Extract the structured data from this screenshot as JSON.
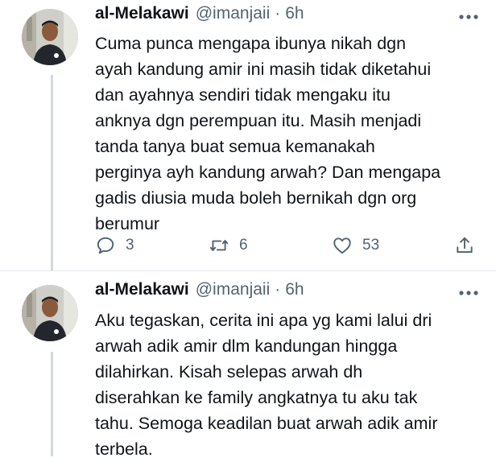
{
  "tweets": [
    {
      "display_name": "al-Melakawi",
      "handle": "@imanjaii",
      "separator": "·",
      "time": "6h",
      "text": "Cuma punca mengapa ibunya nikah dgn\nayah kandung amir ini masih tidak diketahui\ndan ayahnya sendiri tidak mengaku itu\nanknya dgn perempuan itu. Masih menjadi\ntanda tanya buat semua kemanakah\nperginya ayh kandung arwah? Dan mengapa\ngadis diusia muda boleh bernikah dgn org\nberumur",
      "reply_count": "3",
      "retweet_count": "6",
      "like_count": "53"
    },
    {
      "display_name": "al-Melakawi",
      "handle": "@imanjaii",
      "separator": "·",
      "time": "6h",
      "text": "Aku tegaskan, cerita ini apa yg kami lalui dri\narwah adik amir dlm kandungan hingga\ndilahirkan. Kisah selepas arwah dh\ndiserahkan ke family angkatnya tu aku tak\ntahu. Semoga keadilan buat arwah adik amir\nterbela."
    }
  ],
  "icons": {
    "more": "more-horizontal-icon",
    "reply": "reply-icon",
    "retweet": "retweet-icon",
    "like": "heart-icon",
    "share": "share-icon"
  },
  "colors": {
    "text": "#0f1419",
    "secondary": "#536471",
    "thread_line": "#cfd9de"
  }
}
